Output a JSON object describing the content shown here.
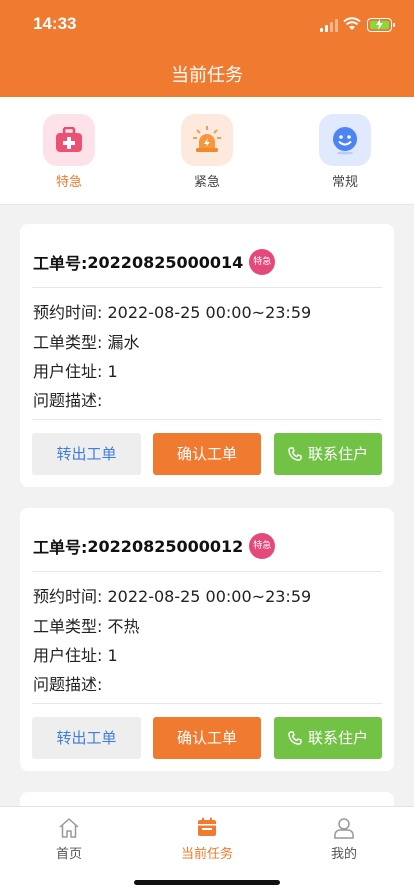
{
  "status_bar": {
    "time": "14:33"
  },
  "header": {
    "title": "当前任务"
  },
  "categories": [
    {
      "label": "特急",
      "icon": "first-aid-kit-icon",
      "tile_color": "#fde3e9",
      "active": true
    },
    {
      "label": "紧急",
      "icon": "alarm-light-icon",
      "tile_color": "#fde9de",
      "active": false
    },
    {
      "label": "常规",
      "icon": "smiley-face-icon",
      "tile_color": "#e1e9ff",
      "active": false
    }
  ],
  "orders": [
    {
      "order_label": "工单号: ",
      "order_no": "20220825000014",
      "badge": "特急",
      "appointment": "预约时间: 2022-08-25 00:00~23:59",
      "type": "工单类型: 漏水",
      "address": "用户住址: 1",
      "description": "问题描述:",
      "buttons": {
        "transfer": "转出工单",
        "confirm": "确认工单",
        "contact": "联系住户"
      }
    },
    {
      "order_label": "工单号: ",
      "order_no": "20220825000012",
      "badge": "特急",
      "appointment": "预约时间: 2022-08-25 00:00~23:59",
      "type": "工单类型: 不热",
      "address": "用户住址: 1",
      "description": "问题描述:",
      "buttons": {
        "transfer": "转出工单",
        "confirm": "确认工单",
        "contact": "联系住户"
      }
    }
  ],
  "tabbar": {
    "items": [
      {
        "label": "首页",
        "icon": "home-icon"
      },
      {
        "label": "当前任务",
        "icon": "calendar-icon"
      },
      {
        "label": "我的",
        "icon": "user-icon"
      }
    ],
    "active_index": 1
  },
  "colors": {
    "accent": "#f07a2f",
    "green": "#71c245",
    "badge": "#e5497a",
    "link": "#3f7de0"
  }
}
